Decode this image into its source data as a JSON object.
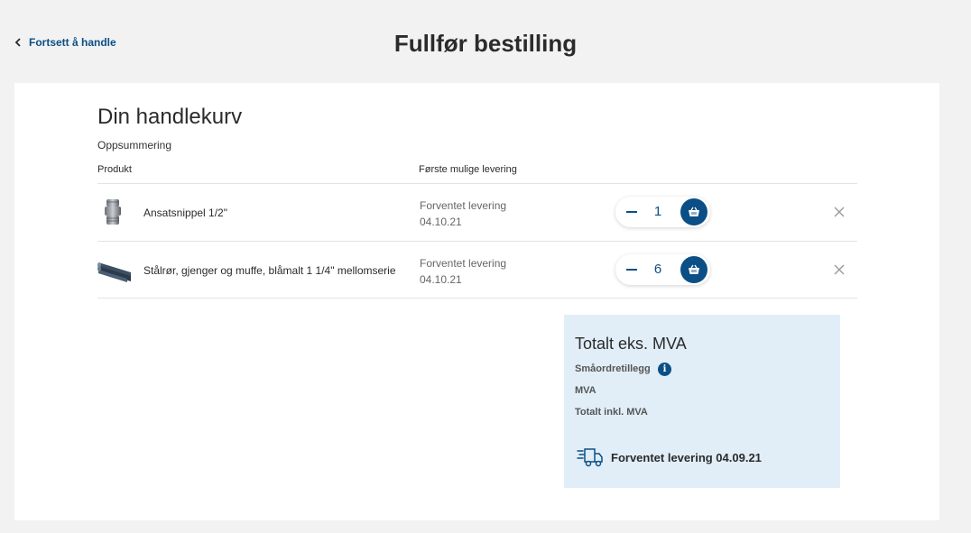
{
  "header": {
    "back_label": "Fortsett å handle",
    "title": "Fullfør bestilling"
  },
  "cart": {
    "heading": "Din handlekurv",
    "summary_label": "Oppsummering",
    "columns": {
      "product": "Produkt",
      "delivery": "Første mulige levering"
    },
    "items": [
      {
        "name": "Ansatsnippel 1/2\"",
        "delivery_label": "Forventet levering",
        "delivery_date": "04.10.21",
        "quantity": "1",
        "thumb_icon": "pipe-nipple-image"
      },
      {
        "name": "Stålrør, gjenger og muffe, blåmalt 1 1/4\" mellomserie",
        "delivery_label": "Forventet levering",
        "delivery_date": "04.10.21",
        "quantity": "6",
        "thumb_icon": "steel-pipes-image"
      }
    ]
  },
  "totals": {
    "title": "Totalt eks. MVA",
    "small_order_fee": "Småordretillegg",
    "vat": "MVA",
    "total_incl_vat": "Totalt inkl. MVA",
    "expected_delivery": "Forventet levering 04.09.21",
    "info_glyph": "i"
  },
  "colors": {
    "accent": "#0b4f86",
    "background": "#f2f2f2",
    "totals_bg": "#e1eef8"
  }
}
